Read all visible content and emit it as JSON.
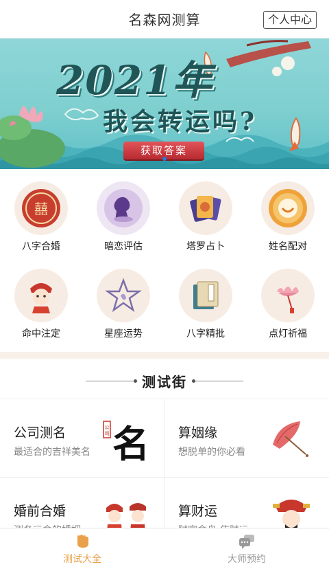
{
  "header": {
    "title": "名森网测算",
    "user_center": "个人中心"
  },
  "banner": {
    "headline": "2021年",
    "subline": "我会转运吗?",
    "cta": "获取答案"
  },
  "features": [
    {
      "label": "八字合婚",
      "icon": "double-happiness-icon"
    },
    {
      "label": "暗恋评估",
      "icon": "sitting-girl-icon"
    },
    {
      "label": "塔罗占卜",
      "icon": "tarot-cards-icon"
    },
    {
      "label": "姓名配对",
      "icon": "name-match-icon"
    },
    {
      "label": "命中注定",
      "icon": "bride-icon"
    },
    {
      "label": "星座运势",
      "icon": "star-icon"
    },
    {
      "label": "八字精批",
      "icon": "book-icon"
    },
    {
      "label": "点灯祈福",
      "icon": "lotus-lantern-icon"
    }
  ],
  "section": {
    "title": "测试街"
  },
  "cards": [
    {
      "title": "公司测名",
      "subtitle": "最适合的吉祥美名",
      "icon": "calligraphy-name-icon"
    },
    {
      "title": "算姻缘",
      "subtitle": "想脱单的你必看",
      "icon": "umbrella-icon"
    },
    {
      "title": "婚前合婚",
      "subtitle": "测各运命的婚姻",
      "icon": "couple-icon"
    },
    {
      "title": "算财运",
      "subtitle": "财富命盘 使财运",
      "icon": "fortune-god-icon"
    }
  ],
  "tabbar": {
    "tabs": [
      {
        "label": "测试大全",
        "icon": "hand-icon",
        "active": true
      },
      {
        "label": "大师预约",
        "icon": "chat-icon",
        "active": false
      }
    ]
  },
  "colors": {
    "accent": "#e9a14b",
    "banner_teal": "#7fcfcf",
    "cta_red": "#c8373d"
  }
}
